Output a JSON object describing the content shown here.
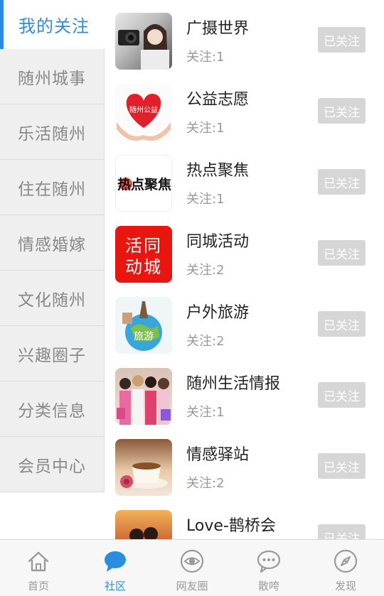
{
  "sidebar": {
    "items": [
      {
        "label": "我的关注",
        "active": true
      },
      {
        "label": "随州城事"
      },
      {
        "label": "乐活随州"
      },
      {
        "label": "住在随州"
      },
      {
        "label": "情感婚嫁"
      },
      {
        "label": "文化随州"
      },
      {
        "label": "兴趣圈子"
      },
      {
        "label": "分类信息"
      },
      {
        "label": "会员中心"
      }
    ]
  },
  "list": {
    "items": [
      {
        "title": "广摄世界",
        "sub": "关注:1",
        "button": "已关注"
      },
      {
        "title": "公益志愿",
        "sub": "关注:1",
        "button": "已关注",
        "thumb_text": "随州公益"
      },
      {
        "title": "热点聚焦",
        "sub": "关注:1",
        "button": "已关注",
        "thumb_text": "热点聚焦"
      },
      {
        "title": "同城活动",
        "sub": "关注:2",
        "button": "已关注",
        "thumb_text": "活同动城"
      },
      {
        "title": "户外旅游",
        "sub": "关注:2",
        "button": "已关注",
        "thumb_text": "旅游"
      },
      {
        "title": "随州生活情报",
        "sub": "关注:1",
        "button": "已关注"
      },
      {
        "title": "情感驿站",
        "sub": "关注:2",
        "button": "已关注"
      },
      {
        "title": "Love-鹊桥会",
        "sub": "",
        "button": "已关注"
      }
    ]
  },
  "bottom_nav": {
    "items": [
      {
        "label": "首页",
        "icon": "home-icon"
      },
      {
        "label": "社区",
        "icon": "chat-bubble-icon",
        "active": true
      },
      {
        "label": "网友圈",
        "icon": "eye-circle-icon"
      },
      {
        "label": "散咵",
        "icon": "dots-bubble-icon"
      },
      {
        "label": "发现",
        "icon": "compass-icon"
      }
    ]
  },
  "colors": {
    "accent": "#2a8ee0",
    "sidebar_bg": "#efefef",
    "button_bg": "#d6d6d6"
  }
}
